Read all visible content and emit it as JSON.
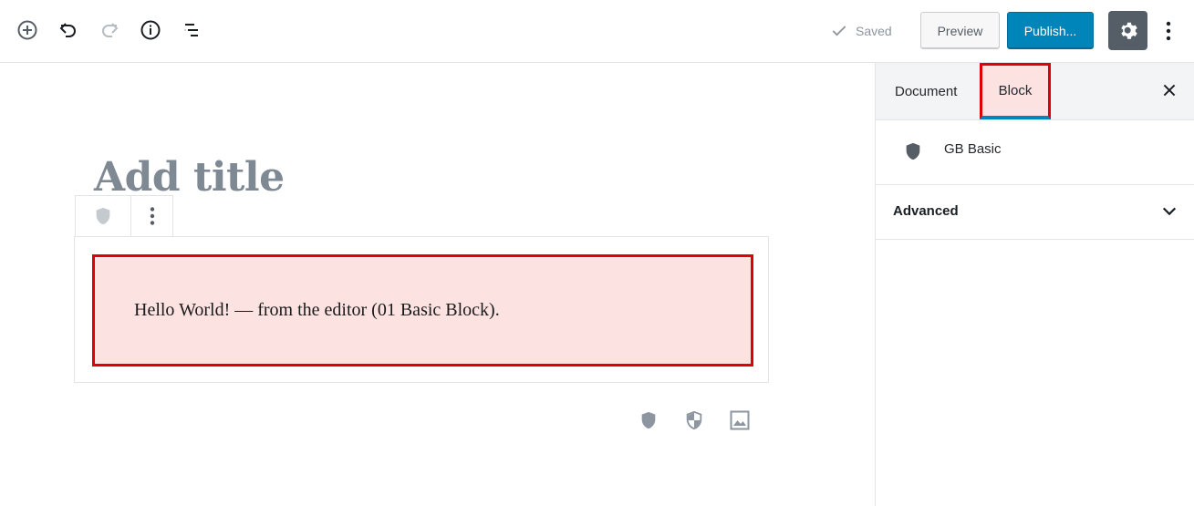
{
  "toolbar": {
    "icons": [
      "add-block-icon",
      "undo-icon",
      "redo-icon",
      "info-icon",
      "outline-icon"
    ],
    "saved_label": "Saved",
    "preview_label": "Preview",
    "publish_label": "Publish...",
    "settings_icon": "gear-icon",
    "more_icon": "vertical-ellipsis-icon"
  },
  "editor": {
    "title_placeholder": "Add title",
    "block_toolbar": {
      "block_icon": "shield-icon",
      "more_icon": "vertical-ellipsis-icon"
    },
    "block": {
      "text": "Hello World! — from the editor (01 Basic Block)."
    },
    "quick_inserters": [
      "shield-icon",
      "shield-half-icon",
      "image-icon"
    ]
  },
  "sidebar": {
    "tabs": [
      {
        "label": "Document",
        "active": false
      },
      {
        "label": "Block",
        "active": true
      }
    ],
    "close_icon": "close-icon",
    "block_info": {
      "icon": "shield-icon",
      "name": "GB Basic"
    },
    "panels": [
      {
        "title": "Advanced",
        "expanded": false
      }
    ]
  },
  "colors": {
    "accent": "#0085ba",
    "block_border": "#e00000",
    "block_background": "#fde2e2",
    "settings_button": "#555d66"
  }
}
